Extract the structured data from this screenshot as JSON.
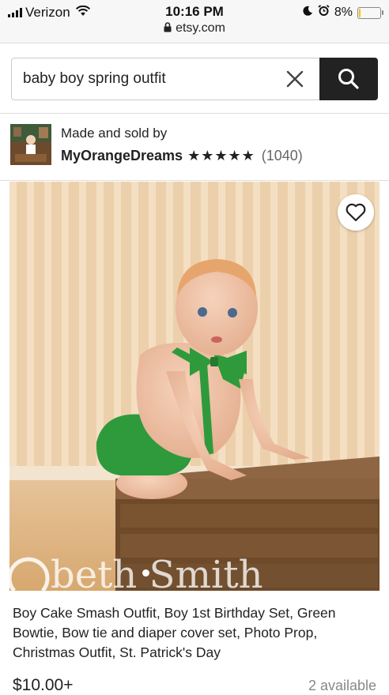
{
  "status_bar": {
    "carrier": "Verizon",
    "time": "10:16 PM",
    "url": "etsy.com",
    "battery": "8%",
    "battery_level": 0.08
  },
  "search": {
    "query": "baby boy spring outfit",
    "clear_icon": "close-icon",
    "search_icon": "search-icon"
  },
  "seller": {
    "made_label": "Made and sold by",
    "shop_name": "MyOrangeDreams",
    "stars": "★★★★★",
    "rating": 5,
    "review_count": "(1040)"
  },
  "listing": {
    "watermark": "beth Smith",
    "title": "Boy Cake Smash Outfit, Boy 1st Birthday Set, Green Bowtie, Bow tie and diaper cover set, Photo Prop, Christmas Outfit, St. Patrick's Day",
    "price": "$10.00+",
    "availability": "2 available"
  },
  "colors": {
    "search_button": "#222222",
    "outfit_green": "#2e9a3c",
    "wall": "#e9c9a0"
  }
}
